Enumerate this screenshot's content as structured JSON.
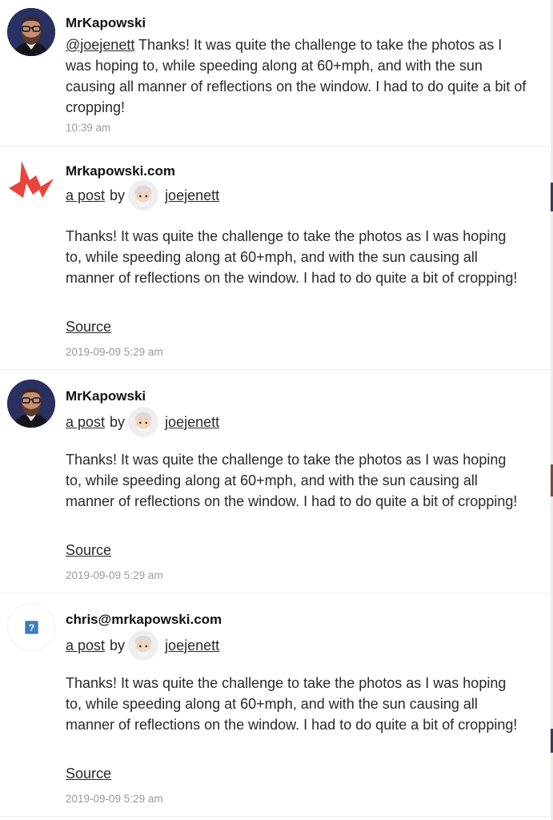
{
  "items": [
    {
      "author": "MrKapowski",
      "avatar": "man-with-beard-glasses",
      "mention": "@joejenett",
      "text": "Thanks! It was quite the challenge to take the photos as I was hoping to, while speeding along at 60+mph, and with the sun causing all manner of reflections on the window. I had to do quite a bit of cropping!",
      "time": "10:39 am"
    },
    {
      "author": "Mrkapowski.com",
      "avatar": "red-lightning-logo",
      "post_link": "a post",
      "by": "by",
      "post_author": "joejenett",
      "text": "Thanks! It was quite the challenge to take the photos as I was hoping to, while speeding along at 60+mph, and with the sun causing all manner of reflections on the window. I had to do quite a bit of cropping!",
      "source": "Source",
      "time": "2019-09-09 5:29 am"
    },
    {
      "author": "MrKapowski",
      "avatar": "man-with-beard-glasses",
      "post_link": "a post",
      "by": "by",
      "post_author": "joejenett",
      "text": "Thanks! It was quite the challenge to take the photos as I was hoping to, while speeding along at 60+mph, and with the sun causing all manner of reflections on the window. I had to do quite a bit of cropping!",
      "source": "Source",
      "time": "2019-09-09 5:29 am"
    },
    {
      "author": "chris@mrkapowski.com",
      "avatar": "broken-image-placeholder",
      "post_link": "a post",
      "by": "by",
      "post_author": "joejenett",
      "text": "Thanks! It was quite the challenge to take the photos as I was hoping to, while speeding along at 60+mph, and with the sun causing all manner of reflections on the window. I had to do quite a bit of cropping!",
      "source": "Source",
      "time": "2019-09-09 5:29 am"
    }
  ],
  "colors": {
    "text": "#2a2a2a",
    "meta": "#9a9a9a",
    "divider": "#ececec",
    "logo_red": "#e8453c"
  }
}
